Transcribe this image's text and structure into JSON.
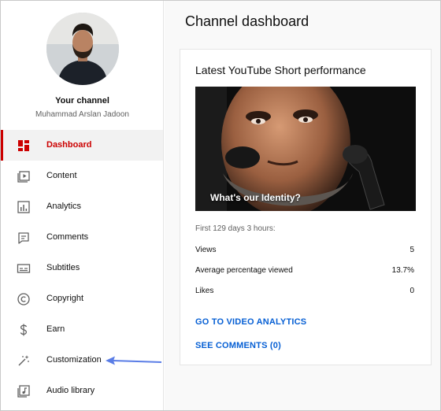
{
  "channel": {
    "title": "Your channel",
    "name": "Muhammad Arslan Jadoon"
  },
  "sidebar": {
    "items": [
      {
        "label": "Dashboard",
        "icon": "dashboard-icon",
        "active": true
      },
      {
        "label": "Content",
        "icon": "content-icon"
      },
      {
        "label": "Analytics",
        "icon": "analytics-icon"
      },
      {
        "label": "Comments",
        "icon": "comments-icon"
      },
      {
        "label": "Subtitles",
        "icon": "subtitles-icon"
      },
      {
        "label": "Copyright",
        "icon": "copyright-icon"
      },
      {
        "label": "Earn",
        "icon": "earn-icon"
      },
      {
        "label": "Customization",
        "icon": "customization-icon"
      },
      {
        "label": "Audio library",
        "icon": "audio-library-icon"
      }
    ]
  },
  "main": {
    "title": "Channel dashboard",
    "card": {
      "title": "Latest YouTube Short performance",
      "thumbnail_caption": "What's our Identity?",
      "period": "First 129 days 3 hours:",
      "stats": [
        {
          "label": "Views",
          "value": "5"
        },
        {
          "label": "Average percentage viewed",
          "value": "13.7%"
        },
        {
          "label": "Likes",
          "value": "0"
        }
      ],
      "analytics_link": "GO TO VIDEO ANALYTICS",
      "comments_link": "SEE COMMENTS (0)"
    }
  },
  "colors": {
    "accent_red": "#cc0000",
    "link_blue": "#065fd4",
    "annotation_arrow": "#5a7de6"
  }
}
